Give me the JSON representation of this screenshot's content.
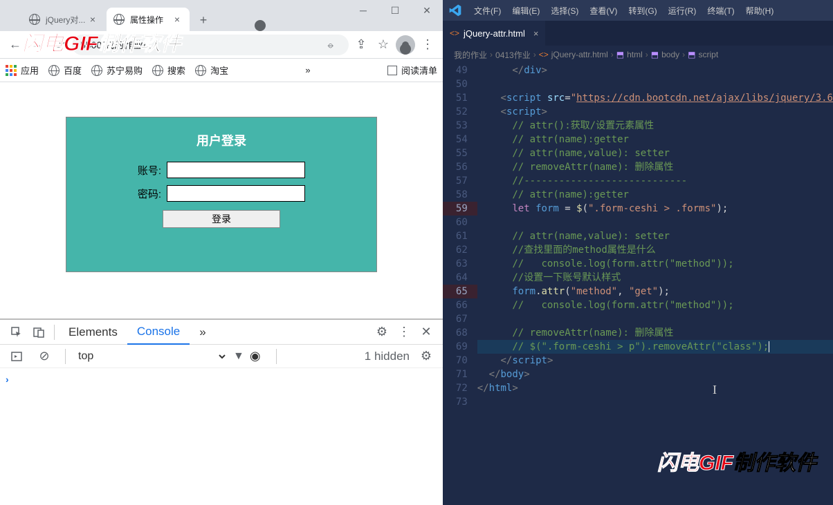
{
  "browser": {
    "tabs": [
      {
        "title": "jQuery对...",
        "active": false
      },
      {
        "title": "属性操作",
        "active": true
      }
    ],
    "address": "5500/我的作业/...",
    "bookmarks": {
      "apps": "应用",
      "items": [
        "百度",
        "苏宁易购",
        "搜索",
        "淘宝"
      ],
      "reading_list": "阅读清单"
    }
  },
  "login_form": {
    "title": "用户登录",
    "username_label": "账号:",
    "password_label": "密码:",
    "submit_label": "登录"
  },
  "devtools": {
    "tabs": {
      "elements": "Elements",
      "console": "Console"
    },
    "context": "top",
    "hidden": "1 hidden"
  },
  "watermark": {
    "red": "闪电GIF",
    "rest": "制作软件"
  },
  "vscode": {
    "menus": [
      "文件(F)",
      "编辑(E)",
      "选择(S)",
      "查看(V)",
      "转到(G)",
      "运行(R)",
      "终端(T)",
      "帮助(H)"
    ],
    "tab": "jQuery-attr.html",
    "breadcrumb": [
      "我的作业",
      "0413作业",
      "jQuery-attr.html",
      "html",
      "body",
      "script"
    ],
    "line_start": 49,
    "line_end": 73,
    "highlighted_lines": [
      59,
      65
    ],
    "code": {
      "l49": "</div>",
      "l51_src": "https://cdn.bootcdn.net/ajax/libs/jquery/3.6",
      "l53": "// attr():获取/设置元素属性",
      "l54": "// attr(name):getter",
      "l55": "// attr(name,value): setter",
      "l56": "// removeAttr(name): 删除属性",
      "l57": "//----------------------------",
      "l58": "// attr(name):getter",
      "l59_sel": "\".form-ceshi > .forms\"",
      "l61": "// attr(name,value): setter",
      "l62": "//查找里面的method属性是什么",
      "l63": "//   console.log(form.attr(\"method\"));",
      "l64": "//设置一下账号默认样式",
      "l65_a": "\"method\"",
      "l65_b": "\"get\"",
      "l66": "//   console.log(form.attr(\"method\"));",
      "l68": "// removeAttr(name): 删除属性",
      "l69": "// $(\".form-ceshi > p\").removeAttr(\"class\");"
    }
  }
}
